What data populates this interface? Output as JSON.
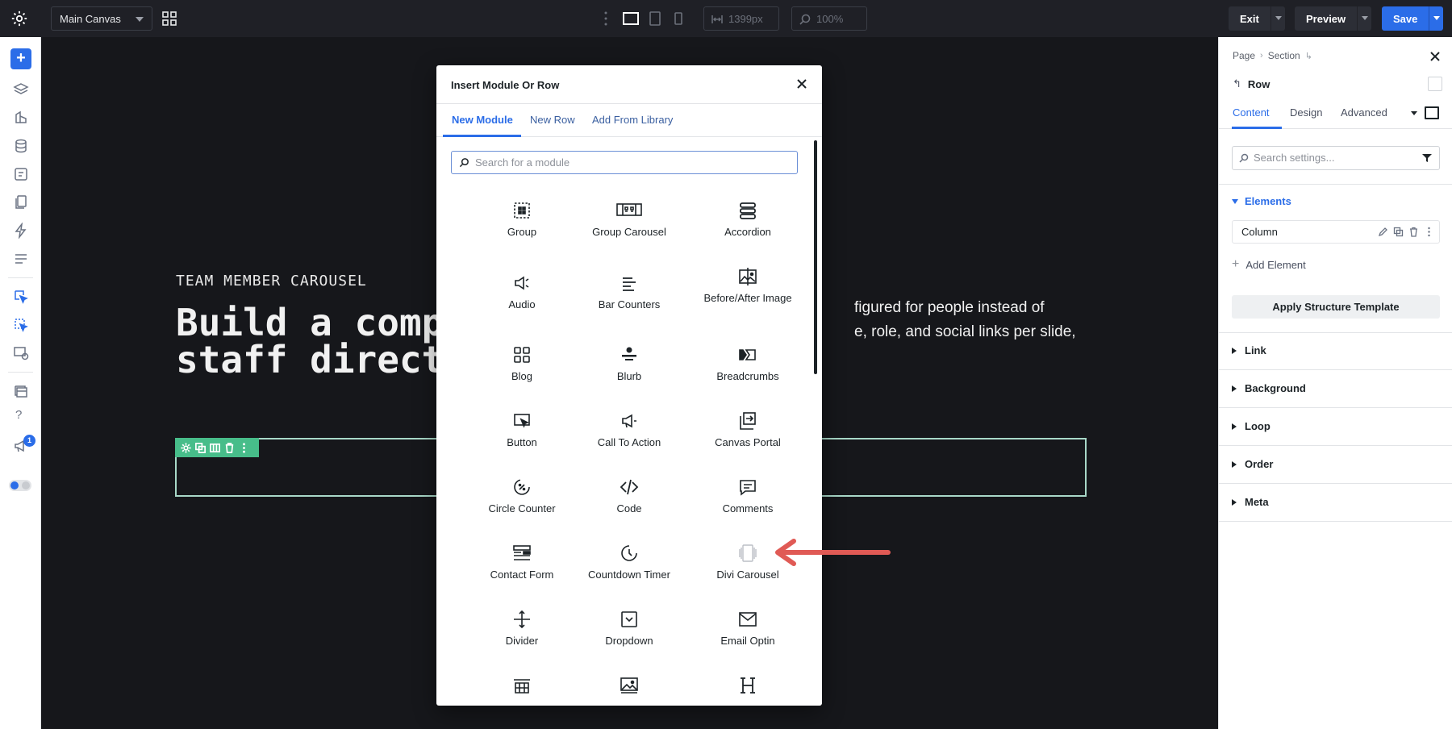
{
  "topbar": {
    "canvas_name": "Main Canvas",
    "width_value": "1399px",
    "zoom_value": "100%",
    "exit_label": "Exit",
    "preview_label": "Preview",
    "save_label": "Save",
    "colors": {
      "bg": "#1f2026",
      "save": "#2b6de8",
      "button": "#2c2e36"
    }
  },
  "leftbar": {
    "icons": [
      "plus-icon",
      "layers-icon",
      "wireframe-icon",
      "database-icon",
      "portability-icon",
      "pages-icon",
      "lightning-icon",
      "list-icon",
      "click-mode-icon",
      "select-mode-icon",
      "responsive-icon",
      "library-icon",
      "help-icon",
      "announcement-icon"
    ],
    "notification_count": "1"
  },
  "canvas": {
    "eyebrow": "TEAM MEMBER CAROUSEL",
    "headline_line1": "Build a comp",
    "headline_line2": "staff direct",
    "body_line1": "figured for people instead of",
    "body_line2": "e, role, and social links per slide,"
  },
  "modal": {
    "title": "Insert Module Or Row",
    "tabs": [
      "New Module",
      "New Row",
      "Add From Library"
    ],
    "search_placeholder": "Search for a module",
    "modules": [
      {
        "label": "Group",
        "icon": "group-icon"
      },
      {
        "label": "Group Carousel",
        "icon": "group-carousel-icon"
      },
      {
        "label": "Accordion",
        "icon": "accordion-icon"
      },
      {
        "label": "Audio",
        "icon": "audio-icon"
      },
      {
        "label": "Bar Counters",
        "icon": "bar-counters-icon"
      },
      {
        "label": "Before/After Image",
        "icon": "before-after-image-icon"
      },
      {
        "label": "Blog",
        "icon": "blog-icon"
      },
      {
        "label": "Blurb",
        "icon": "blurb-icon"
      },
      {
        "label": "Breadcrumbs",
        "icon": "breadcrumbs-icon"
      },
      {
        "label": "Button",
        "icon": "button-icon"
      },
      {
        "label": "Call To Action",
        "icon": "call-to-action-icon"
      },
      {
        "label": "Canvas Portal",
        "icon": "canvas-portal-icon"
      },
      {
        "label": "Circle Counter",
        "icon": "circle-counter-icon"
      },
      {
        "label": "Code",
        "icon": "code-icon"
      },
      {
        "label": "Comments",
        "icon": "comments-icon"
      },
      {
        "label": "Contact Form",
        "icon": "contact-form-icon"
      },
      {
        "label": "Countdown Timer",
        "icon": "countdown-timer-icon"
      },
      {
        "label": "Divi Carousel",
        "icon": "divi-carousel-icon"
      },
      {
        "label": "Divider",
        "icon": "divider-icon"
      },
      {
        "label": "Dropdown",
        "icon": "dropdown-icon"
      },
      {
        "label": "Email Optin",
        "icon": "email-optin-icon"
      },
      {
        "label": "",
        "icon": "filterable-portfolio-icon"
      },
      {
        "label": "",
        "icon": "gallery-icon"
      },
      {
        "label": "",
        "icon": "heading-icon"
      }
    ],
    "highlight_color": "#e05a55"
  },
  "panel": {
    "breadcrumb": [
      "Page",
      "Section"
    ],
    "element_title": "Row",
    "tabs": [
      "Content",
      "Design",
      "Advanced"
    ],
    "search_placeholder": "Search settings...",
    "elements_heading": "Elements",
    "column_label": "Column",
    "add_element_label": "Add Element",
    "apply_template_label": "Apply Structure Template",
    "sections": [
      "Link",
      "Background",
      "Loop",
      "Order",
      "Meta"
    ],
    "accent_color": "#2b6de8"
  }
}
